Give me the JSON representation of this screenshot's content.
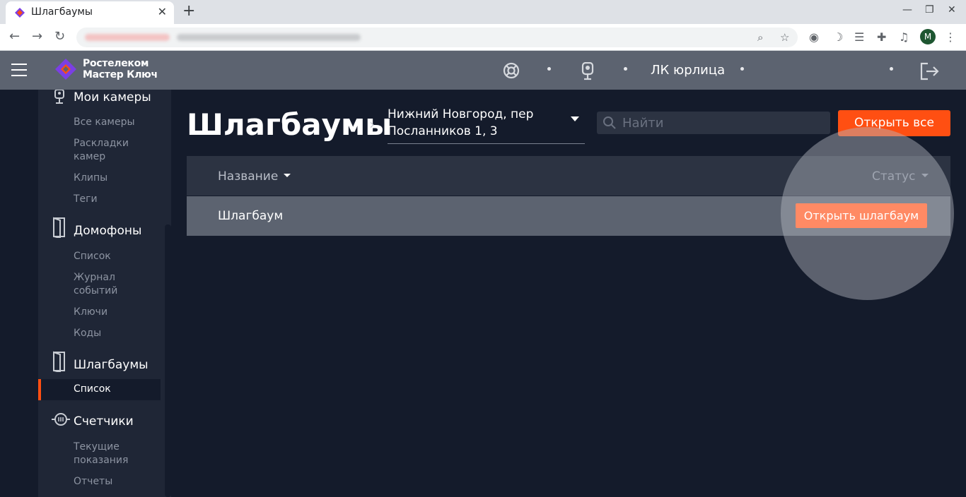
{
  "browser": {
    "tab_title": "Шлагбаумы",
    "new_tab": "+",
    "close_tab": "✕",
    "window_controls": [
      "—",
      "❐",
      "✕"
    ],
    "profile_initial": "M",
    "icons": [
      "zoom-icon",
      "star-icon",
      "extension-icon",
      "puzzle-icon",
      "media-icon",
      "menu-icon"
    ]
  },
  "header": {
    "logo_line1": "Ростелеком",
    "logo_line2": "Мастер Ключ",
    "org_name": "ЛК юрлица",
    "brand_color": "#ff4f12",
    "logo_colors": [
      "#7b3fe4",
      "#ff4f12"
    ]
  },
  "sidebar": {
    "cameras": {
      "title": "Мои камеры",
      "items": [
        "Все камеры",
        "Раскладки камер",
        "Клипы",
        "Теги"
      ]
    },
    "intercoms": {
      "title": "Домофоны",
      "items": [
        "Список",
        "Журнал событий",
        "Ключи",
        "Коды"
      ]
    },
    "barriers": {
      "title": "Шлагбаумы",
      "items": [
        "Список"
      ]
    },
    "meters": {
      "title": "Счетчики",
      "items": [
        "Текущие показания",
        "Отчеты"
      ]
    }
  },
  "main": {
    "title": "Шлагбаумы",
    "breadcrumb_separator": "›",
    "address": "Нижний Новгород, пер Посланников 1, 3",
    "search_placeholder": "Найти",
    "open_all_label": "Открыть все",
    "table": {
      "columns": [
        "Название",
        "Статус"
      ],
      "rows": [
        {
          "name": "Шлагбаум",
          "action": "Открыть шлагбаум"
        }
      ]
    }
  }
}
